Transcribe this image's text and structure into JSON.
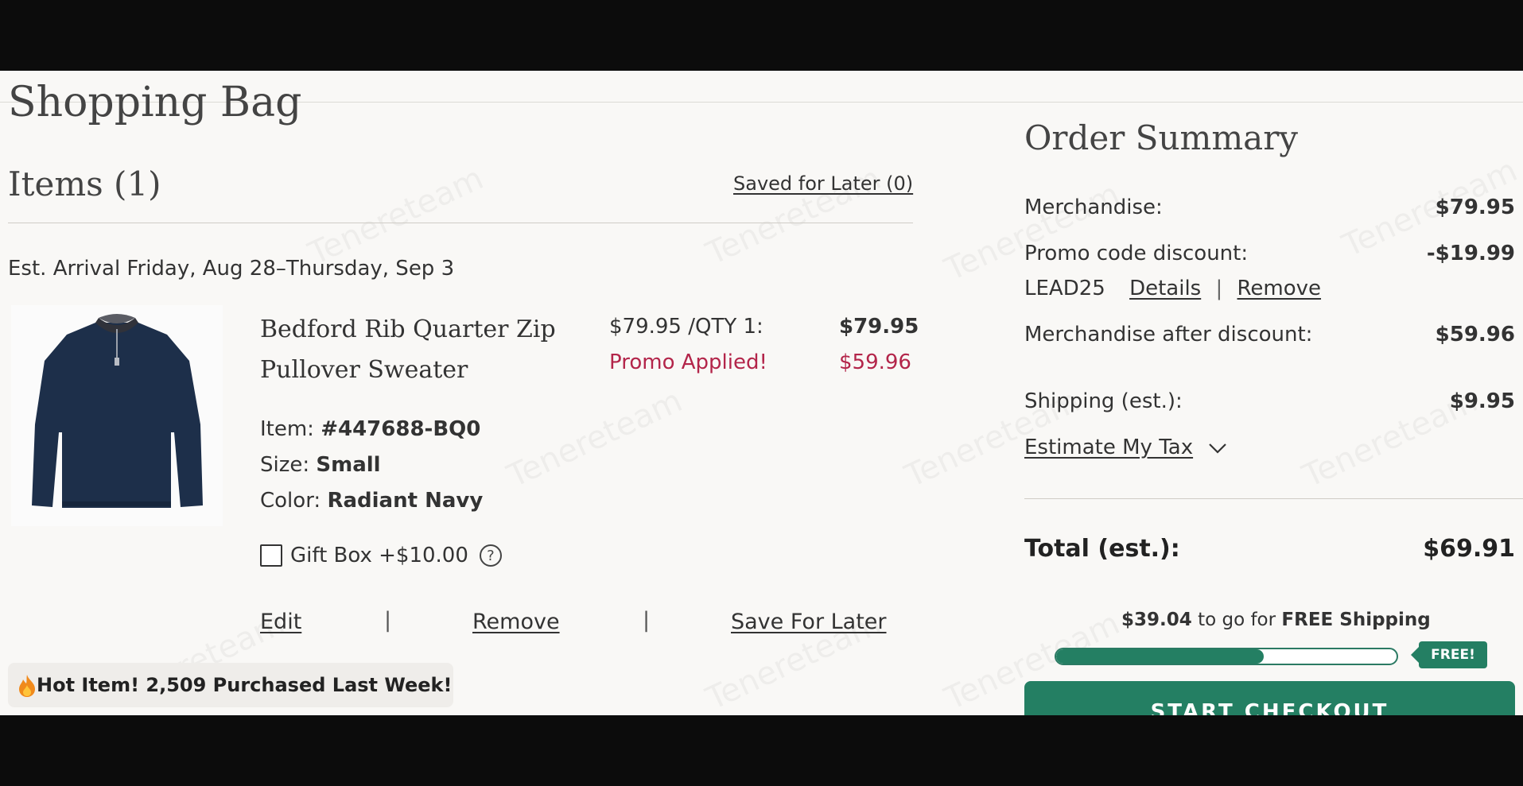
{
  "page": {
    "title": "Shopping Bag"
  },
  "items_header": {
    "title": "Items (1)",
    "saved_for_later": "Saved for Later (0)"
  },
  "arrival": "Est. Arrival Friday, Aug 28–Thursday, Sep 3",
  "product": {
    "name_line1": "Bedford Rib Quarter Zip",
    "name_line2": "Pullover Sweater",
    "unit_price": "$79.95 /QTY 1:",
    "line_price": "$79.95",
    "promo_label": "Promo Applied!",
    "promo_price": "$59.96",
    "item_label": "Item:",
    "item_value": "#447688-BQ0",
    "size_label": "Size:",
    "size_value": "Small",
    "color_label": "Color:",
    "color_value": "Radiant Navy",
    "gift_box_label": "Gift Box +$10.00",
    "gift_box_checked": false,
    "help_glyph": "?",
    "sweater_color": "#1d2f4a"
  },
  "actions": {
    "edit": "Edit",
    "remove": "Remove",
    "save_for_later": "Save For Later",
    "separator": "|"
  },
  "hot_item": "Hot Item! 2,509 Purchased Last Week!",
  "summary": {
    "title": "Order Summary",
    "merchandise_label": "Merchandise:",
    "merchandise_value": "$79.95",
    "promo_label": "Promo code discount:",
    "promo_value": "-$19.99",
    "promo_code": "LEAD25",
    "details": "Details",
    "remove": "Remove",
    "separator": "|",
    "after_discount_label": "Merchandise after discount:",
    "after_discount_value": "$59.96",
    "shipping_label": "Shipping (est.):",
    "shipping_value": "$9.95",
    "estimate_tax": "Estimate My Tax",
    "total_label": "Total (est.):",
    "total_value": "$69.91"
  },
  "free_shipping": {
    "amount": "$39.04",
    "middle_text": "to go for",
    "strong_text": "FREE Shipping",
    "progress_percent": 61,
    "badge": "FREE!"
  },
  "checkout": {
    "label": "START CHECKOUT"
  },
  "watermark": {
    "text": "Tenereteam"
  },
  "colors": {
    "accent_green": "#247f63",
    "discount_red": "#b3254a",
    "page_bg": "#f9f8f6"
  }
}
